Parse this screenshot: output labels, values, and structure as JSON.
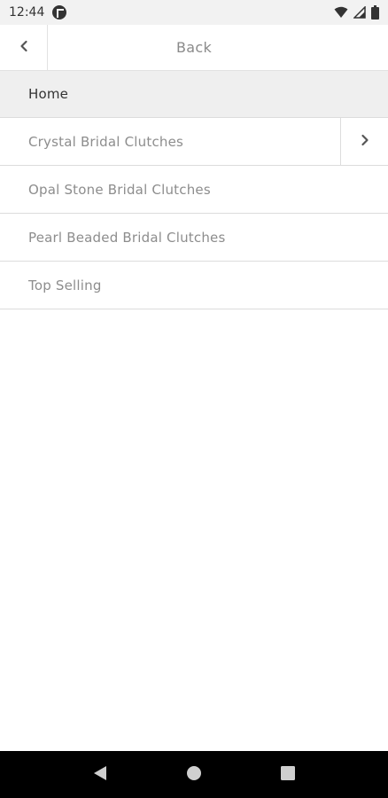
{
  "status_bar": {
    "time": "12:44",
    "icons": [
      "app-notification-icon",
      "wifi-icon",
      "signal-icon",
      "battery-icon"
    ]
  },
  "header": {
    "back_icon": "chevron-left-icon",
    "title": "Back"
  },
  "menu": {
    "items": [
      {
        "label": "Home",
        "highlighted": true
      },
      {
        "label": "Crystal Bridal Clutches",
        "has_submenu": true,
        "submenu_icon": "chevron-right-icon"
      },
      {
        "label": "Opal Stone Bridal Clutches"
      },
      {
        "label": "Pearl Beaded Bridal Clutches"
      },
      {
        "label": "Top Selling"
      }
    ]
  },
  "nav_bar": {
    "buttons": [
      "back-triangle-icon",
      "home-circle-icon",
      "recents-square-icon"
    ]
  },
  "colors": {
    "status_bar_bg": "#f2f2f2",
    "highlight_bg": "#efefef",
    "text_primary": "#333333",
    "text_muted": "#8d8d8d",
    "divider": "#dcdcdc",
    "nav_bar_bg": "#000000"
  }
}
